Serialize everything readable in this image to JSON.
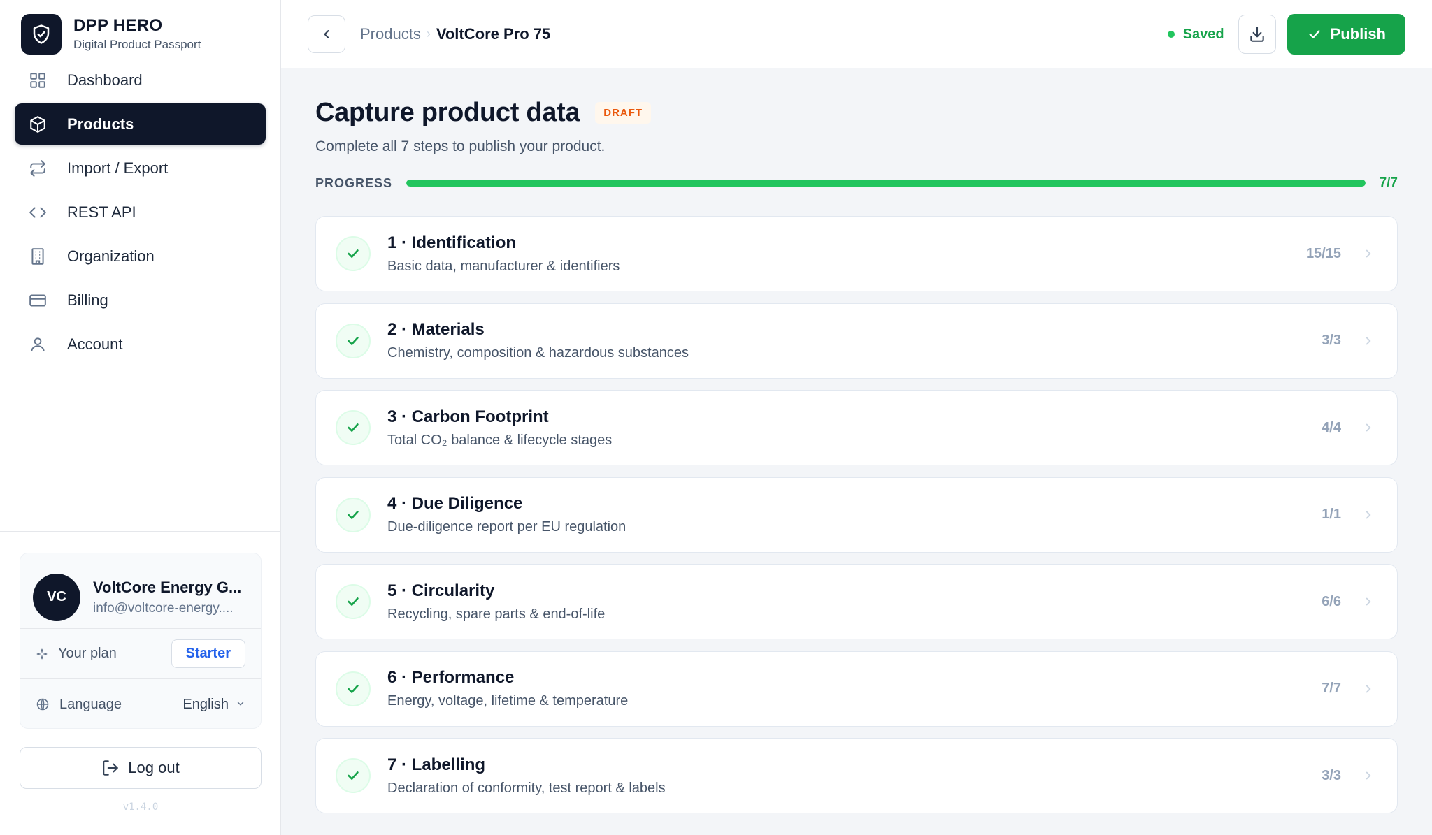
{
  "brand": {
    "name": "DPP HERO",
    "subtitle": "Digital Product Passport",
    "logo_icon": "shield-check-icon"
  },
  "nav": {
    "items": [
      {
        "label": "Dashboard",
        "icon": "grid-icon",
        "active": false
      },
      {
        "label": "Products",
        "icon": "box-icon",
        "active": true
      },
      {
        "label": "Import / Export",
        "icon": "arrows-swap-icon",
        "active": false
      },
      {
        "label": "REST API",
        "icon": "code-icon",
        "active": false
      },
      {
        "label": "Organization",
        "icon": "building-icon",
        "active": false
      },
      {
        "label": "Billing",
        "icon": "credit-card-icon",
        "active": false
      },
      {
        "label": "Account",
        "icon": "user-icon",
        "active": false
      }
    ]
  },
  "account": {
    "initials": "VC",
    "name": "VoltCore Energy G...",
    "email": "info@voltcore-energy....",
    "plan_label": "Your plan",
    "plan_value": "Starter",
    "language_label": "Language",
    "language_value": "English"
  },
  "logout_label": "Log out",
  "version": "v1.4.0",
  "topbar": {
    "breadcrumb_parent": "Products",
    "breadcrumb_separator": "›",
    "breadcrumb_current": "VoltCore Pro 75",
    "saved_label": "Saved",
    "publish_label": "Publish"
  },
  "page": {
    "title": "Capture product data",
    "status_badge": "DRAFT",
    "subtitle": "Complete all 7 steps to publish your product.",
    "progress_label": "PROGRESS",
    "progress_count": "7/7",
    "progress_fraction": 1.0
  },
  "steps": [
    {
      "title": "1 · Identification",
      "desc": "Basic data, manufacturer & identifiers",
      "count": "15/15"
    },
    {
      "title": "2 · Materials",
      "desc": "Chemistry, composition & hazardous substances",
      "count": "3/3"
    },
    {
      "title": "3 · Carbon Footprint",
      "desc": "Total CO₂ balance & lifecycle stages",
      "count": "4/4"
    },
    {
      "title": "4 · Due Diligence",
      "desc": "Due-diligence report per EU regulation",
      "count": "1/1"
    },
    {
      "title": "5 · Circularity",
      "desc": "Recycling, spare parts & end-of-life",
      "count": "6/6"
    },
    {
      "title": "6 · Performance",
      "desc": "Energy, voltage, lifetime & temperature",
      "count": "7/7"
    },
    {
      "title": "7 · Labelling",
      "desc": "Declaration of conformity, test report & labels",
      "count": "3/3"
    }
  ],
  "colors": {
    "accent": "#16a34a",
    "sidebar_active": "#0f172a",
    "draft": "#ea580c",
    "link": "#2563eb"
  }
}
